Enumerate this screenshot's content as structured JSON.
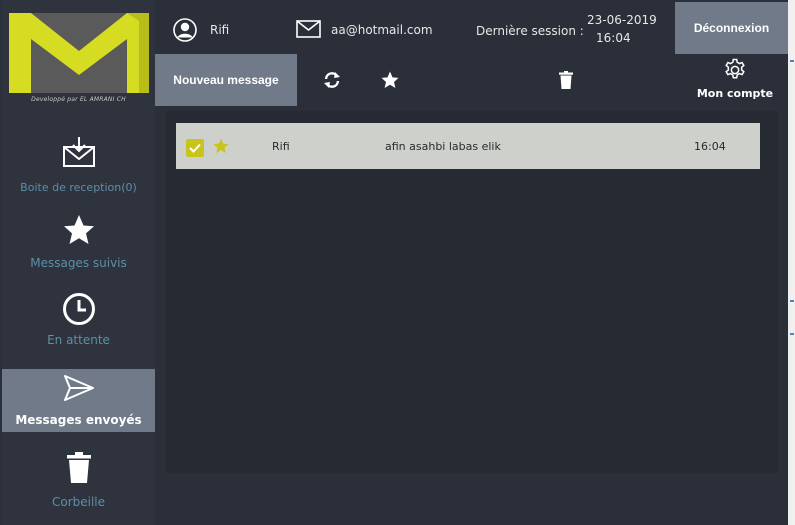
{
  "colors": {
    "accent": "#c8cc1f",
    "sidebar_bg": "#2f333d",
    "panel_bg": "#2b2f3a",
    "active_item_bg": "#707a89",
    "nav_label": "#5d8fa8",
    "row_bg": "#cdd0cb"
  },
  "logo": {
    "credit": "Developpé par EL AMRANI CH",
    "icon": "envelope-logo"
  },
  "header": {
    "user_name": "Rifi",
    "email": "aa@hotmail.com",
    "last_session_label": "Dernière session :",
    "last_session_date": "23-06-2019",
    "last_session_time": "16:04",
    "logout_label": "Déconnexion"
  },
  "toolbar": {
    "new_message_label": "Nouveau message",
    "refresh_icon": "refresh-icon",
    "star_icon": "star-icon",
    "delete_icon": "trash-icon",
    "account_label": "Mon compte"
  },
  "sidebar": {
    "items": [
      {
        "label": "Boite de reception(0)",
        "icon": "inbox-icon",
        "active": false
      },
      {
        "label": "Messages suivis",
        "icon": "star-icon",
        "active": false
      },
      {
        "label": "En attente",
        "icon": "clock-icon",
        "active": false
      },
      {
        "label": "Messages envoyés",
        "icon": "send-icon",
        "active": true
      },
      {
        "label": "Corbeille",
        "icon": "trash-icon",
        "active": false
      }
    ]
  },
  "messages": [
    {
      "checked": true,
      "starred": true,
      "sender": "Rifi",
      "subject": "afin asahbi labas elik",
      "time": "16:04"
    }
  ]
}
